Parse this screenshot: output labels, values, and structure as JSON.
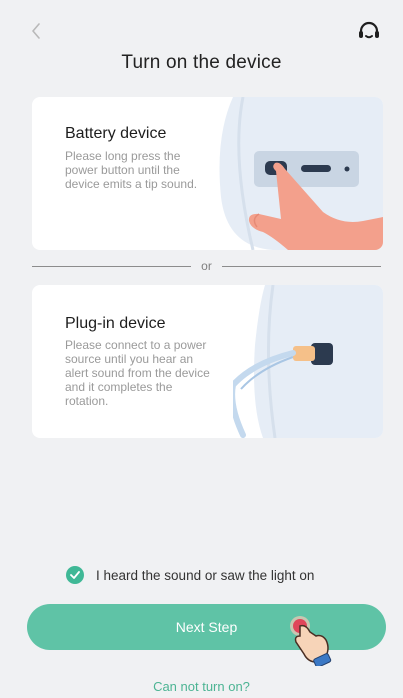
{
  "header": {
    "title": "Turn on the device"
  },
  "options": {
    "separator": "or",
    "battery": {
      "title": "Battery device",
      "description": "Please long press the power button until the device emits a tip sound."
    },
    "plug_in": {
      "title": "Plug-in device",
      "description": "Please connect to a power source until you hear an alert sound from the device and it completes the rotation."
    }
  },
  "confirmation": {
    "label": "I heard the sound or saw the light on",
    "checked": true
  },
  "actions": {
    "next_label": "Next Step",
    "help_link": "Can not turn on?"
  },
  "colors": {
    "accent": "#5fc3a6",
    "check": "#3fb896",
    "link": "#4cb493",
    "background": "#f0f1f3"
  },
  "icons": {
    "back": "chevron-left-icon",
    "support": "headset-icon",
    "check": "check-circle-icon"
  }
}
